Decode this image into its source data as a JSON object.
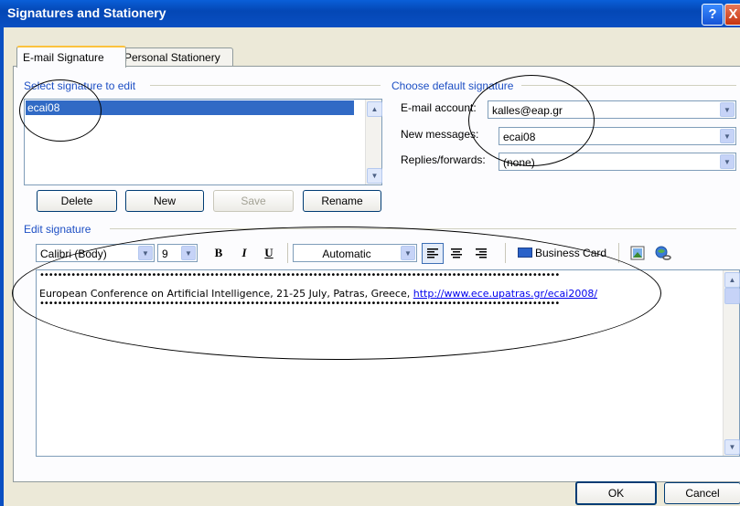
{
  "window": {
    "title": "Signatures and Stationery",
    "help_glyph": "?",
    "close_glyph": "X"
  },
  "tabs": [
    {
      "label": "E-mail Signature"
    },
    {
      "label": "Personal Stationery"
    }
  ],
  "select_group": {
    "label": "Select signature to edit",
    "items": [
      "ecai08"
    ]
  },
  "buttons": {
    "delete": "Delete",
    "new": "New",
    "save": "Save",
    "rename": "Rename",
    "ok": "OK",
    "cancel": "Cancel"
  },
  "default_group": {
    "label": "Choose default signature",
    "email_account_label": "E-mail account:",
    "email_account_value": "kalles@eap.gr",
    "new_messages_label": "New messages:",
    "new_messages_value": "ecai08",
    "replies_label": "Replies/forwards:",
    "replies_value": "(none)"
  },
  "edit_group": {
    "label": "Edit signature"
  },
  "toolbar": {
    "font": "Calibri (Body)",
    "size": "9",
    "bold": "B",
    "italic": "I",
    "underline": "U",
    "color": "Automatic",
    "business_card": "Business Card"
  },
  "signature": {
    "dots": "••••••••••••••••••••••••••••••••••••••••••••••••••••••••••••••••••••••••••••••••••••••••••••••••••••••••••••••••••••",
    "text": "European Conference on Artificial Intelligence, 21-25 July, Patras, Greece, ",
    "link": "http://www.ece.upatras.gr/ecai2008/"
  },
  "colors": {
    "titlebar": "#0a4fc2",
    "selection": "#316ac5",
    "group_label": "#1d4fc4"
  }
}
